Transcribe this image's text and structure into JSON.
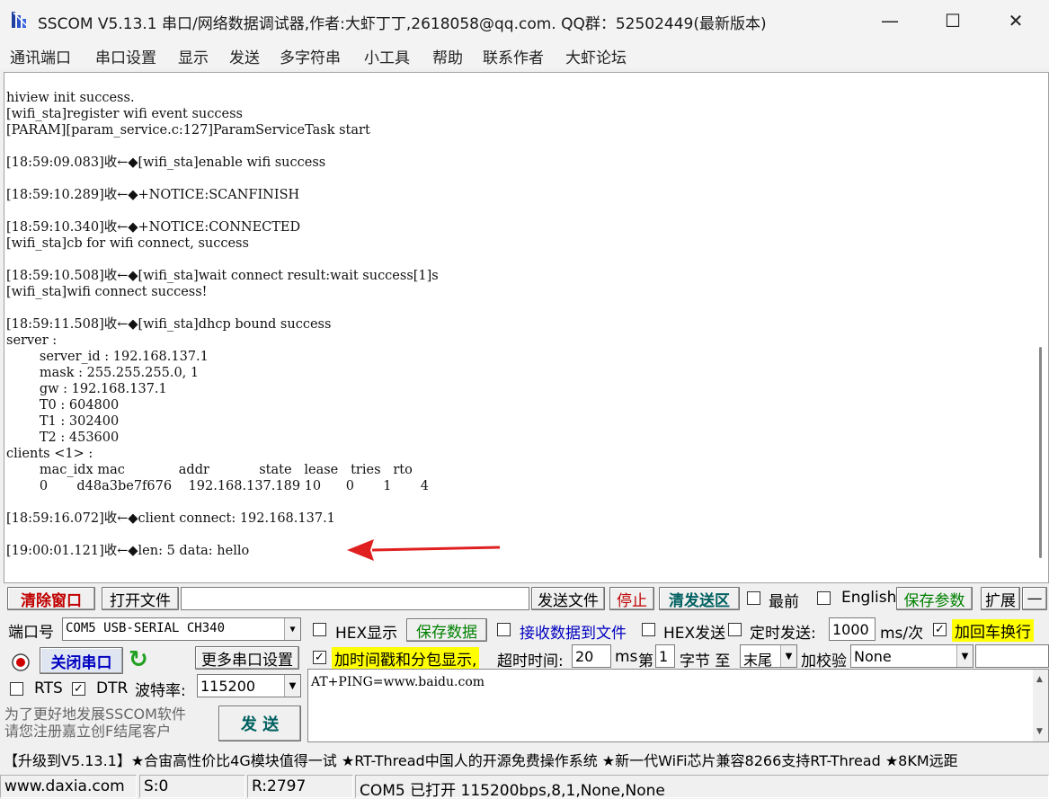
{
  "window": {
    "title": "SSCOM V5.13.1 串口/网络数据调试器,作者:大虾丁丁,2618058@qq.com. QQ群：52502449(最新版本)",
    "min": "—",
    "max": "☐",
    "close": "✕"
  },
  "menu": [
    "通讯端口",
    "串口设置",
    "显示",
    "发送",
    "多字符串",
    "小工具",
    "帮助",
    "联系作者",
    "大虾论坛"
  ],
  "receive_log": [
    "hiview init success.",
    "[wifi_sta]register wifi event success",
    "[PARAM][param_service.c:127]ParamServiceTask start",
    "",
    "[18:59:09.083]收←◆[wifi_sta]enable wifi success",
    "",
    "[18:59:10.289]收←◆+NOTICE:SCANFINISH",
    "",
    "[18:59:10.340]收←◆+NOTICE:CONNECTED",
    "[wifi_sta]cb for wifi connect, success",
    "",
    "[18:59:10.508]收←◆[wifi_sta]wait connect result:wait success[1]s",
    "[wifi_sta]wifi connect success!",
    "",
    "[18:59:11.508]收←◆[wifi_sta]dhcp bound success",
    "server :",
    "        server_id : 192.168.137.1",
    "        mask : 255.255.255.0, 1",
    "        gw : 192.168.137.1",
    "        T0 : 604800",
    "        T1 : 302400",
    "        T2 : 453600",
    "clients <1> :",
    "        mac_idx mac             addr            state   lease   tries   rto",
    "        0       d48a3be7f676    192.168.137.189 10      0       1       4",
    "",
    "[18:59:16.072]收←◆client connect: 192.168.137.1",
    "",
    "[19:00:01.121]收←◆len: 5 data: hello"
  ],
  "toolbar": {
    "clear_window": "清除窗口",
    "open_file": "打开文件",
    "file_path": "",
    "send_file": "发送文件",
    "stop": "停止",
    "clear_send": "清发送区",
    "topmost": "最前",
    "english": "English",
    "save_params": "保存参数",
    "expand": "扩展",
    "collapse": "—"
  },
  "port": {
    "port_label": "端口号",
    "port_value": "COM5 USB-SERIAL CH340",
    "close_port": "关闭串口",
    "refresh_icon": "↻",
    "more_settings": "更多串口设置",
    "rts": "RTS",
    "dtr": "DTR",
    "baud_label": "波特率:",
    "baud_value": "115200"
  },
  "options": {
    "hex_display": "HEX显示",
    "save_data": "保存数据",
    "recv_to_file": "接收数据到文件",
    "hex_send": "HEX发送",
    "timed_send": "定时发送:",
    "interval_value": "1000",
    "interval_unit": "ms/次",
    "add_crlf": "加回车换行",
    "timestamp": "加时间戳和分包显示,",
    "timeout_label": "超时时间:",
    "timeout_value": "20",
    "timeout_unit": "ms",
    "byte_prefix": "第",
    "byte_value": "1",
    "byte_suffix": "字节 至",
    "tail_value": "末尾",
    "checksum_label": "加校验",
    "checksum_value": "None"
  },
  "send": {
    "text": "AT+PING=www.baidu.com",
    "button": "发 送",
    "promo1": "为了更好地发展SSCOM软件",
    "promo2": "请您注册嘉立创F结尾客户"
  },
  "ticker": "【升级到V5.13.1】★合宙高性价比4G模块值得一试 ★RT-Thread中国人的开源免费操作系统 ★新一代WiFi芯片兼容8266支持RT-Thread ★8KM远距",
  "status": {
    "website": "www.daxia.com",
    "sent": "S:0",
    "received": "R:2797",
    "port_status": "COM5 已打开  115200bps,8,1,None,None"
  },
  "colors": {
    "accent_red": "#c00000",
    "accent_green": "#008000",
    "highlight": "#ffff00",
    "arrow": "#e02020"
  }
}
